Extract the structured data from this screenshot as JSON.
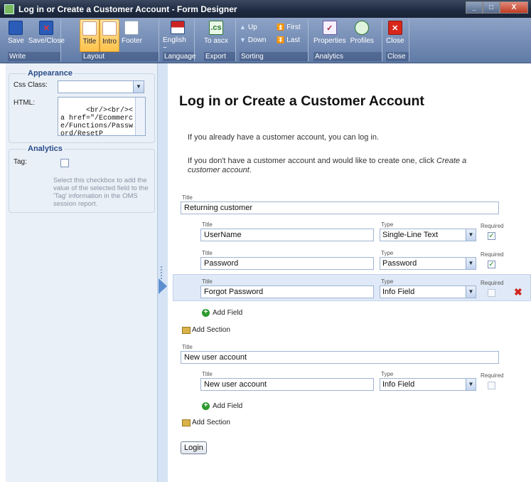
{
  "window": {
    "title": "Log in or Create a Customer Account - Form Designer",
    "controls": [
      "_",
      "□",
      "X"
    ]
  },
  "ribbon": {
    "groups": [
      {
        "name": "Write",
        "buttons": [
          {
            "label": "Save",
            "icon": "floppy-icon"
          },
          {
            "label": "Save/Close",
            "icon": "floppy-close-icon"
          }
        ]
      },
      {
        "name": "Layout",
        "buttons": [
          {
            "label": "Title",
            "icon": "title-layout-icon",
            "active": true
          },
          {
            "label": "Intro",
            "icon": "intro-layout-icon",
            "active": true
          },
          {
            "label": "Footer",
            "icon": "footer-layout-icon"
          }
        ]
      },
      {
        "name": "Language",
        "buttons": [
          {
            "label": "English ~",
            "icon": "flag-icon"
          }
        ]
      },
      {
        "name": "Export",
        "buttons": [
          {
            "label": "To ascx",
            "icon": "ascx-export-icon",
            "icon_text": ".cs"
          }
        ]
      },
      {
        "name": "Sorting",
        "buttons": [
          {
            "label": "Up"
          },
          {
            "label": "Down"
          },
          {
            "label": "First"
          },
          {
            "label": "Last"
          }
        ]
      },
      {
        "name": "Analytics",
        "buttons": [
          {
            "label": "Properties",
            "icon": "properties-icon"
          },
          {
            "label": "Profiles",
            "icon": "profiles-icon"
          }
        ]
      },
      {
        "name": "Close",
        "buttons": [
          {
            "label": "Close",
            "icon": "close-icon"
          }
        ]
      }
    ]
  },
  "sidebar": {
    "appearance": {
      "legend": "Appearance",
      "css_class_label": "Css Class:",
      "css_class_value": "",
      "html_label": "HTML:",
      "html_value": "<br/><br/><a href=\"/Ecommerce/Functions/Password/ResetP"
    },
    "analytics": {
      "legend": "Analytics",
      "tag_label": "Tag:",
      "tag_checked": false,
      "tag_hint": "Select this checkbox to add the value of the selected field to the 'Tag' information in the OMS session report."
    }
  },
  "form": {
    "heading": "Log in or Create a Customer Account",
    "intro_line1": "If you already have a customer account, you can log in.",
    "intro_line2_plain": "If you don't have a customer account and would like to create one, click ",
    "intro_line2_link": "Create a customer account",
    "intro_line2_end": ".",
    "title_label": "Title",
    "type_label": "Type",
    "required_label": "Required",
    "sections": [
      {
        "title": "Returning customer",
        "fields": [
          {
            "title": "UserName",
            "type": "Single-Line Text",
            "required": true
          },
          {
            "title": "Password",
            "type": "Password",
            "required": true
          },
          {
            "title": "Forgot Password",
            "type": "Info Field",
            "required": false,
            "selected": true
          }
        ]
      },
      {
        "title": "New user account",
        "fields": [
          {
            "title": "New user account",
            "type": "Info Field",
            "required": false
          }
        ]
      }
    ],
    "add_field_label": "Add Field",
    "add_section_label": "Add Section",
    "login_button": "Login"
  }
}
